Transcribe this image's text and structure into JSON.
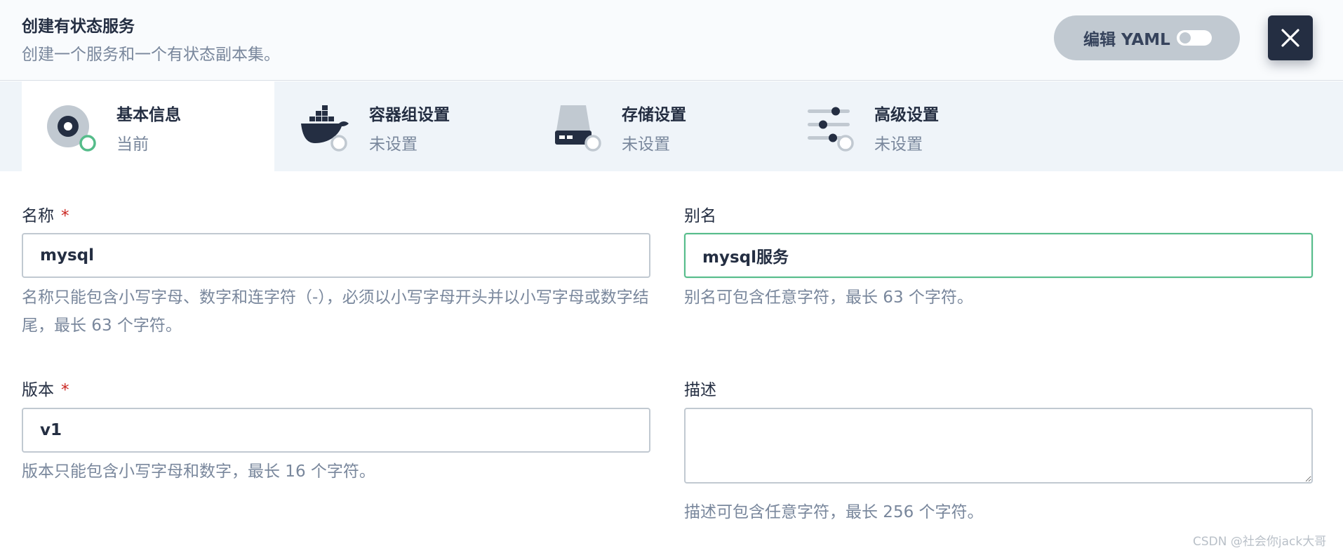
{
  "header": {
    "title": "创建有状态服务",
    "subtitle": "创建一个服务和一个有状态副本集。",
    "yaml_label": "编辑 YAML"
  },
  "steps": [
    {
      "title": "基本信息",
      "status": "当前",
      "icon": "basic-info-icon"
    },
    {
      "title": "容器组设置",
      "status": "未设置",
      "icon": "docker-icon"
    },
    {
      "title": "存储设置",
      "status": "未设置",
      "icon": "storage-icon"
    },
    {
      "title": "高级设置",
      "status": "未设置",
      "icon": "sliders-icon"
    }
  ],
  "form": {
    "name": {
      "label": "名称",
      "required_mark": "*",
      "value": "mysql",
      "help": "名称只能包含小写字母、数字和连字符（-），必须以小写字母开头并以小写字母或数字结尾，最长 63 个字符。"
    },
    "alias": {
      "label": "别名",
      "value": "mysql服务",
      "help": "别名可包含任意字符，最长 63 个字符。"
    },
    "version": {
      "label": "版本",
      "required_mark": "*",
      "value": "v1",
      "help": "版本只能包含小写字母和数字，最长 16 个字符。"
    },
    "description": {
      "label": "描述",
      "value": "",
      "help": "描述可包含任意字符，最长 256 个字符。"
    }
  },
  "watermark": "CSDN @社会你jack大哥",
  "colors": {
    "primary_dark": "#242e42",
    "muted_text": "#79879c",
    "success_green": "#55bc8a",
    "required_red": "#ca2621",
    "border": "#c1c9d1",
    "steps_bg": "#eff4f9"
  }
}
